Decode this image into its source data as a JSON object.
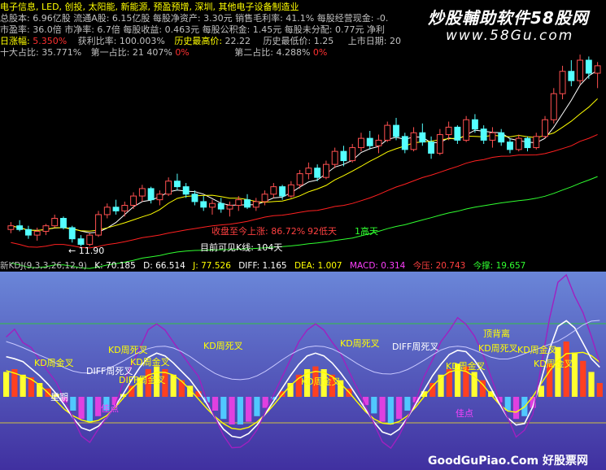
{
  "colors": {
    "bg": "#000000",
    "info_text": "#c0c0c0",
    "yellow": "#ffff00",
    "red": "#ff3030",
    "up_candle": "#ff5050",
    "down_candle": "#54ffff",
    "ma_white": "#ffffff",
    "ma_yellow": "#ffff00",
    "ma_red": "#ff2020",
    "ma_green": "#30ff30",
    "lower_bg_top": "#6a86d8",
    "lower_bg_bottom": "#4030a0"
  },
  "header": {
    "row1": "电子信息, LED, 创投, 太阳能, 新能源, 预盈预增, 深圳, 其他电子设备制造业",
    "row2": "总股本: 6.96亿股  流通A股: 6.15亿股  每股净资产: 3.30元  销售毛利率: 41.1%  每股经营现金: -0.",
    "row3": "市盈率: 36.0倍  市净率: 6.7倍  每股收益: 0.463元  每股公积金: 1.45元  每股未分配: 0.77元  净利",
    "row4_label": "日涨幅:",
    "row4_value": "5.350%",
    "row4_mid": "获利比率: 100.003%",
    "row4_hist_high_label": "历史最高价:",
    "row4_hist_high_value": "22.22",
    "row4_hist_low": "历史最低价: 1.25",
    "row4_list": "上市日期: 20",
    "row5_label": "十大占比: 35.771%",
    "row5_first": "第一占比: 21 407%",
    "row5_first_pct": "0%",
    "row5_second": "第二占比: 4.288%",
    "row5_second_pct": "0%"
  },
  "watermark": {
    "title": "炒股輔助软件58股网",
    "url": "www.58Gu.com",
    "bottom": "GoodGuPiao.Com 好股票网"
  },
  "annotations": {
    "low_price": "← 11.90",
    "rise_label": "收盘至今上涨: 86.72%",
    "fall_days": "92低天",
    "high_days": "1高天",
    "visible_k": "目前可见K线: 104天"
  },
  "indicator_bar": {
    "name": "新KDJ(9,3,3,26,12,9)",
    "k": "K: 70.185",
    "d": "D: 66.514",
    "j": "J: 77.526",
    "diff": "DIFF: 1.165",
    "dea": "DEA: 1.007",
    "macd": "MACD: 0.314",
    "pressure": "今压: 20.743",
    "support": "今撑: 19.657"
  },
  "lower_labels": [
    {
      "text": "KD周金叉",
      "color": "#ffff00"
    },
    {
      "text": "KD周死叉",
      "color": "#ffff00"
    },
    {
      "text": "KD周金叉",
      "color": "#ffff00"
    },
    {
      "text": "DIFF周死叉",
      "color": "#ffffff"
    },
    {
      "text": "DIFF周金叉",
      "color": "#ffff00"
    },
    {
      "text": "KD周死叉",
      "color": "#ffff00"
    },
    {
      "text": "KD周金叉",
      "color": "#ffff00"
    },
    {
      "text": "星期",
      "color": "#ffffff"
    },
    {
      "text": "佳点",
      "color": "#ff40ff"
    },
    {
      "text": "KD周死叉",
      "color": "#ffff00"
    },
    {
      "text": "DIFF周死叉",
      "color": "#ffffff"
    },
    {
      "text": "KD周金叉",
      "color": "#ffff00"
    },
    {
      "text": "KD周金叉",
      "color": "#ffff00"
    },
    {
      "text": "佳点",
      "color": "#ff40ff"
    },
    {
      "text": "顶背离",
      "color": "#ffff00"
    },
    {
      "text": "KD周死叉",
      "color": "#ffff00"
    },
    {
      "text": "KD周金叉",
      "color": "#ffff00"
    }
  ],
  "chart_data": [
    {
      "type": "candlestick",
      "description_series": "weekly candles with moving averages",
      "price_min": 11.9,
      "ohlc": [
        [
          12.8,
          13.2,
          12.6,
          13.0
        ],
        [
          13.0,
          13.3,
          12.7,
          12.8
        ],
        [
          12.8,
          13.0,
          12.3,
          12.5
        ],
        [
          12.5,
          12.9,
          12.2,
          12.7
        ],
        [
          12.7,
          13.1,
          12.5,
          13.0
        ],
        [
          13.0,
          13.6,
          12.9,
          13.4
        ],
        [
          13.4,
          13.5,
          12.8,
          12.9
        ],
        [
          12.9,
          13.0,
          12.1,
          12.3
        ],
        [
          12.3,
          12.5,
          11.9,
          12.0
        ],
        [
          12.0,
          12.6,
          11.9,
          12.5
        ],
        [
          12.5,
          13.8,
          12.4,
          13.6
        ],
        [
          13.6,
          14.2,
          13.4,
          14.0
        ],
        [
          14.0,
          14.4,
          13.6,
          13.8
        ],
        [
          13.8,
          14.3,
          13.5,
          14.1
        ],
        [
          14.1,
          14.8,
          13.9,
          14.6
        ],
        [
          14.6,
          15.2,
          14.3,
          15.0
        ],
        [
          15.0,
          15.1,
          14.2,
          14.4
        ],
        [
          14.4,
          14.9,
          14.1,
          14.7
        ],
        [
          14.7,
          15.6,
          14.6,
          15.4
        ],
        [
          15.4,
          15.8,
          14.9,
          15.1
        ],
        [
          15.1,
          15.3,
          14.5,
          14.7
        ],
        [
          14.7,
          14.9,
          14.1,
          14.3
        ],
        [
          14.3,
          14.6,
          13.8,
          14.0
        ],
        [
          14.0,
          14.4,
          13.6,
          14.2
        ],
        [
          14.2,
          14.5,
          13.7,
          13.9
        ],
        [
          13.9,
          14.3,
          13.5,
          14.1
        ],
        [
          14.1,
          14.6,
          13.8,
          14.4
        ],
        [
          14.4,
          14.7,
          13.9,
          14.0
        ],
        [
          14.0,
          14.5,
          13.8,
          14.3
        ],
        [
          14.3,
          14.9,
          14.1,
          14.7
        ],
        [
          14.7,
          15.3,
          14.5,
          15.1
        ],
        [
          15.1,
          15.2,
          14.4,
          14.6
        ],
        [
          14.6,
          15.4,
          14.5,
          15.2
        ],
        [
          15.2,
          16.0,
          15.0,
          15.8
        ],
        [
          15.8,
          16.4,
          15.5,
          16.1
        ],
        [
          16.1,
          16.3,
          15.4,
          15.6
        ],
        [
          15.6,
          16.5,
          15.5,
          16.3
        ],
        [
          16.3,
          17.2,
          16.1,
          17.0
        ],
        [
          17.0,
          17.3,
          16.2,
          16.5
        ],
        [
          16.5,
          17.4,
          16.4,
          17.2
        ],
        [
          17.2,
          18.0,
          17.0,
          17.7
        ],
        [
          17.7,
          18.1,
          17.1,
          17.3
        ],
        [
          17.3,
          17.9,
          16.9,
          17.6
        ],
        [
          17.6,
          18.6,
          17.5,
          18.4
        ],
        [
          18.4,
          18.8,
          17.6,
          17.8
        ],
        [
          17.8,
          18.0,
          16.9,
          17.1
        ],
        [
          17.1,
          18.3,
          17.0,
          18.0
        ],
        [
          18.0,
          18.5,
          17.3,
          17.5
        ],
        [
          17.5,
          17.8,
          16.6,
          16.9
        ],
        [
          16.9,
          18.2,
          16.8,
          17.9
        ],
        [
          17.9,
          18.6,
          17.6,
          18.3
        ],
        [
          18.3,
          18.4,
          17.4,
          17.6
        ],
        [
          17.6,
          18.9,
          17.5,
          18.7
        ],
        [
          18.7,
          19.0,
          18.0,
          18.2
        ],
        [
          18.2,
          18.4,
          17.4,
          17.6
        ],
        [
          17.6,
          18.3,
          17.2,
          18.0
        ],
        [
          18.0,
          18.2,
          17.3,
          17.5
        ],
        [
          17.5,
          17.7,
          16.9,
          17.1
        ],
        [
          17.1,
          17.9,
          17.0,
          17.7
        ],
        [
          17.7,
          17.8,
          17.0,
          17.2
        ],
        [
          17.2,
          18.0,
          17.1,
          17.8
        ],
        [
          17.8,
          18.9,
          17.7,
          18.7
        ],
        [
          18.7,
          20.4,
          18.5,
          20.1
        ],
        [
          20.1,
          21.6,
          19.8,
          21.3
        ],
        [
          21.3,
          21.9,
          20.5,
          20.8
        ],
        [
          20.8,
          22.2,
          20.6,
          21.9
        ],
        [
          21.9,
          22.1,
          20.9,
          21.2
        ],
        [
          21.2,
          21.8,
          20.4,
          21.6
        ]
      ]
    },
    {
      "type": "bar",
      "description_series": "lower indicator histogram: positive (warm) and negative (cool) bars",
      "values": [
        0.9,
        1.0,
        0.8,
        0.7,
        0.5,
        0.3,
        0.1,
        -0.2,
        -0.5,
        -0.8,
        -0.9,
        -0.7,
        -0.5,
        -0.3,
        0.1,
        0.4,
        0.7,
        1.0,
        1.1,
        1.0,
        0.8,
        0.6,
        0.4,
        0.2,
        -0.2,
        -0.5,
        -0.8,
        -1.0,
        -1.0,
        -0.9,
        -0.7,
        -0.4,
        -0.1,
        0.2,
        0.5,
        0.8,
        1.0,
        1.1,
        1.0,
        0.8,
        0.6,
        0.3,
        0.0,
        -0.3,
        -0.6,
        -0.9,
        -1.0,
        -0.8,
        -0.5,
        -0.2,
        0.2,
        0.5,
        0.8,
        1.0,
        1.2,
        1.1,
        0.9,
        0.6,
        0.2,
        -0.2,
        -0.5,
        -0.8,
        -0.7,
        -0.4,
        0.4,
        1.2,
        1.8,
        2.0,
        1.6,
        1.3,
        0.9,
        0.5
      ]
    }
  ]
}
